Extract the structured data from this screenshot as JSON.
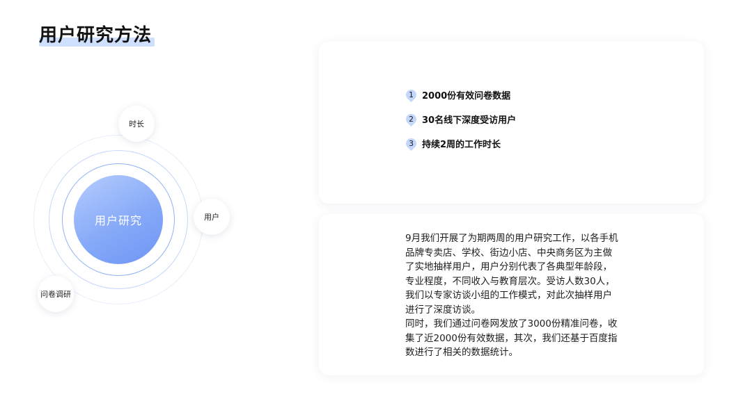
{
  "page": {
    "title": "用户研究方法"
  },
  "diagram": {
    "center_label": "用户研究",
    "nodes": {
      "time": "时长",
      "user": "用户",
      "questionnaire": "问卷调研"
    }
  },
  "stats": [
    {
      "num": "1",
      "text": "2000份有效问卷数据"
    },
    {
      "num": "2",
      "text": "30名线下深度受访用户"
    },
    {
      "num": "3",
      "text": "持续2周的工作时长"
    }
  ],
  "description": {
    "paragraph_1": "9月我们开展了为期两周的用户研究工作，以各手机品牌专卖店、学校、街边小店、中央商务区为主做了实地抽样用户，用户分别代表了各典型年龄段，专业程度，不同收入与教育层次。受访人数30人，我们以专家访谈小组的工作模式，对此次抽样用户进行了深度访谈。",
    "paragraph_2": "同时，我们通过问卷网发放了3000份精准问卷，收集了近2000份有效数据，其次，我们还基于百度指数进行了相关的数据统计。"
  },
  "colors": {
    "accent": "#86a9f8",
    "accent_light": "#c3d6fc",
    "title_highlight": "#cfe0ff"
  }
}
